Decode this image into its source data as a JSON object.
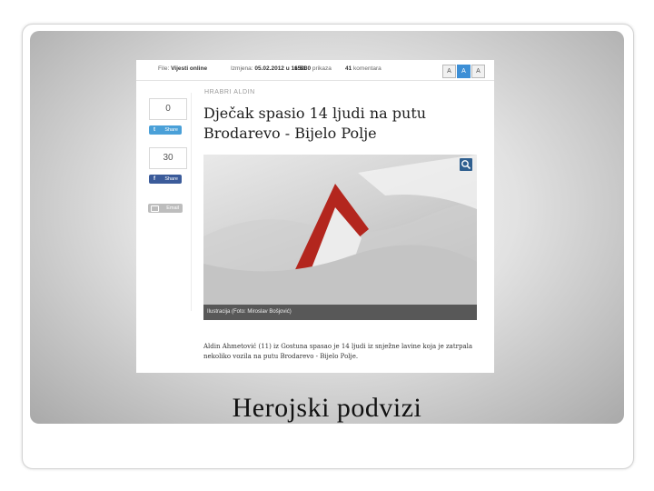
{
  "slide": {
    "caption": "Herojski podvizi"
  },
  "article_meta": {
    "file_label": "File:",
    "file_value": "Vijesti online",
    "changed_label": "Izmjena:",
    "changed_value": "05.02.2012 u 16:51",
    "views_value": "15030",
    "views_label": "prikaza",
    "comments_value": "41",
    "comments_label": "komentara",
    "font_buttons": [
      "A",
      "A",
      "A"
    ]
  },
  "share": {
    "twitter_count": "0",
    "twitter_label": "Share",
    "facebook_count": "30",
    "facebook_label": "Share",
    "email_label": "Email"
  },
  "article": {
    "kicker": "HRABRI ALDIN",
    "headline": "Dječak spasio 14 ljudi na putu Brodarevo - Bijelo Polje",
    "photo_caption": "Ilustracija (Foto: Miroslav Bošjović)",
    "lead": "Aldin Ahmetović (11) iz Gostuna spasao je 14 ljudi iz snježne lavine koja je zatrpala nekoliko vozila na putu Brodarevo - Bijelo Polje."
  },
  "colors": {
    "twitter": "#4aa0d8",
    "facebook": "#3b5b9a",
    "accent": "#3d8fd6",
    "sign_red": "#b3261e"
  }
}
